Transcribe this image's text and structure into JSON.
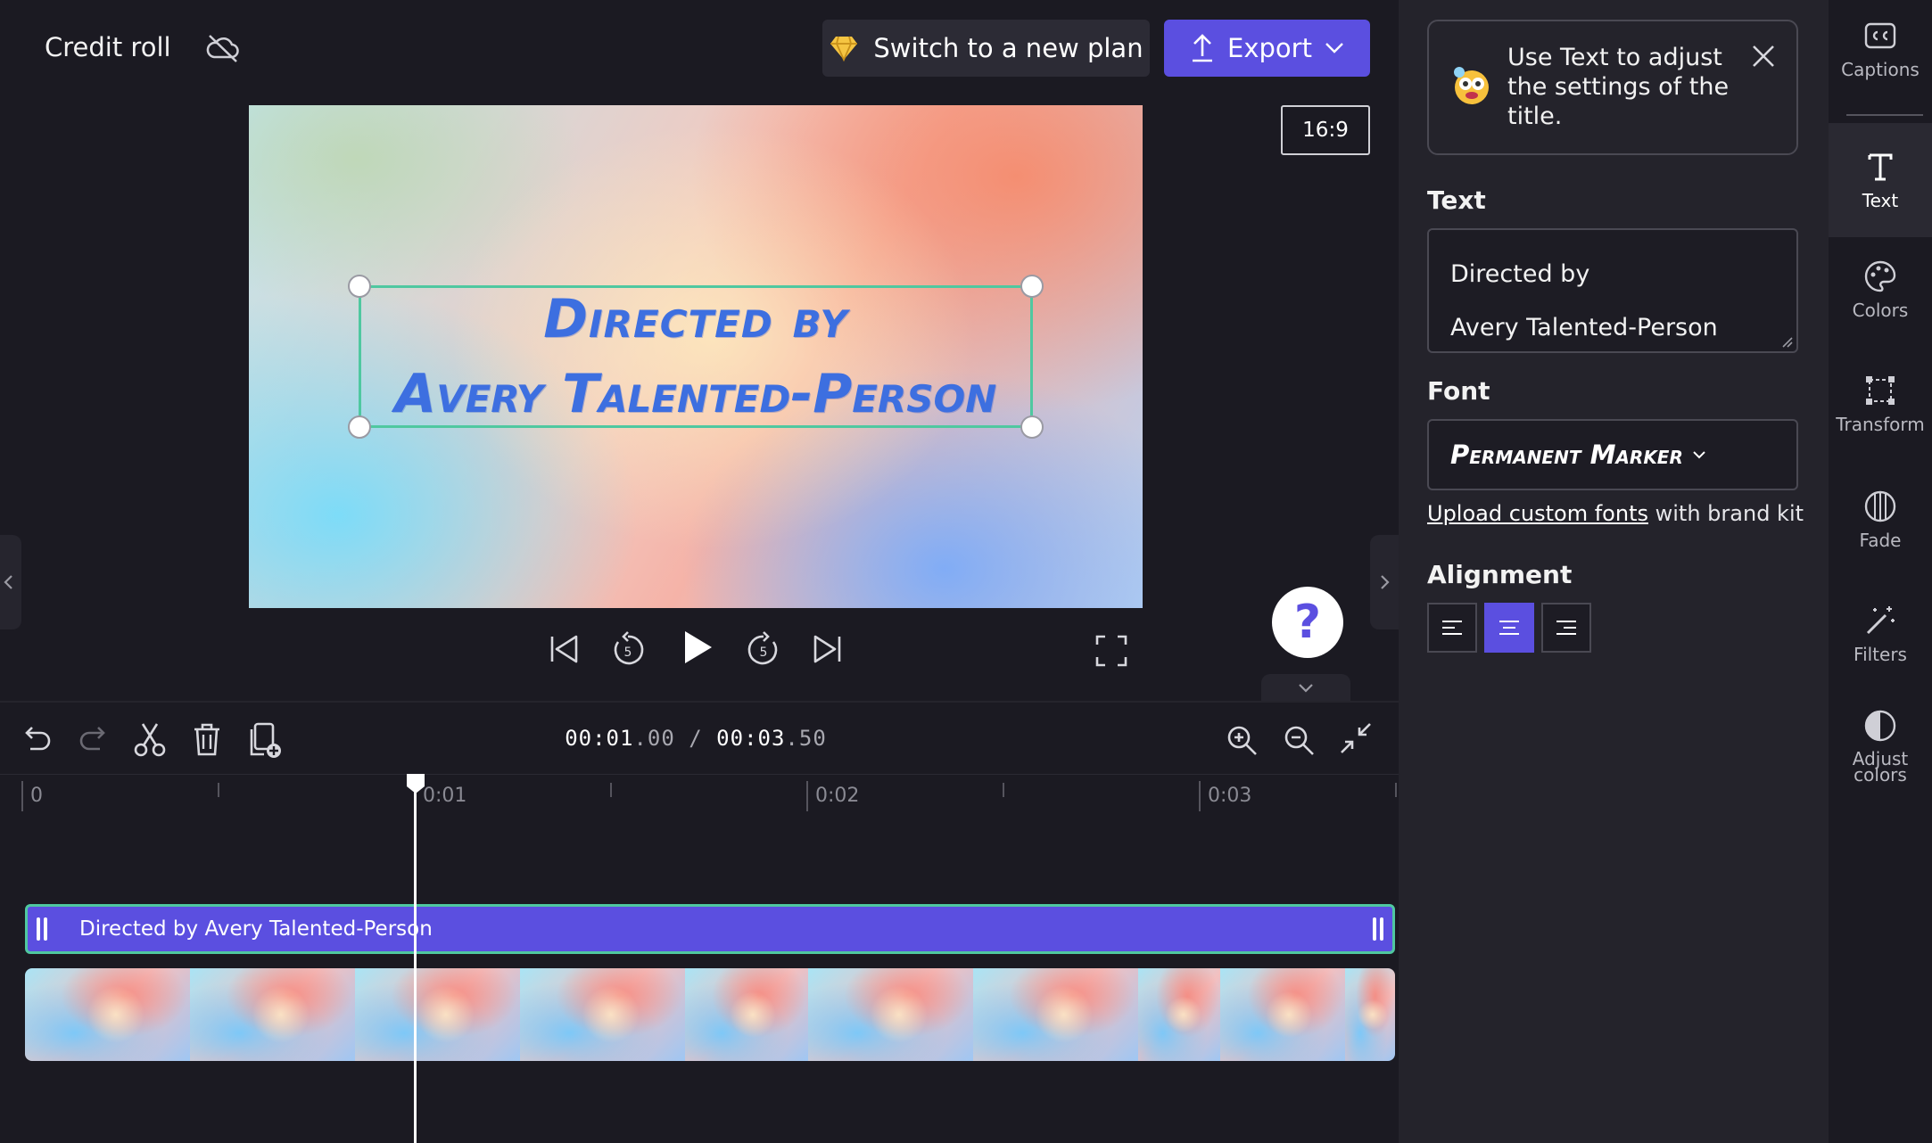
{
  "header": {
    "project_title": "Credit roll",
    "plan_button_label": "Switch to a new plan",
    "export_button_label": "Export",
    "aspect_ratio": "16:9"
  },
  "preview": {
    "title_line1": "Directed by",
    "title_line2": "Avery Talented-Person",
    "title_color": "#3d6fe0",
    "selection_color": "#4fc8a0"
  },
  "playback": {
    "current_time": "00:01",
    "current_frac": ".00",
    "separator": " / ",
    "total_time": "00:03",
    "total_frac": ".50"
  },
  "timeline": {
    "tick_labels": [
      "0",
      "0:01",
      "0:02",
      "0:03"
    ],
    "text_clip_label": "Directed by Avery Talented-Person",
    "playhead_seconds": 1.0
  },
  "panel": {
    "tip_text": "Use Text to adjust the settings of the title.",
    "text_heading": "Text",
    "text_value_line1": "Directed by",
    "text_value_line2": "Avery Talented-Person",
    "font_heading": "Font",
    "font_value": "Permanent Marker",
    "upload_link": "Upload custom fonts",
    "upload_rest": " with brand kit",
    "alignment_heading": "Alignment",
    "alignment_selected": "center"
  },
  "rail": [
    {
      "label": "Captions",
      "icon": "captions-icon"
    },
    {
      "label": "Text",
      "icon": "text-icon",
      "active": true
    },
    {
      "label": "Colors",
      "icon": "palette-icon"
    },
    {
      "label": "Transform",
      "icon": "transform-icon"
    },
    {
      "label": "Fade",
      "icon": "fade-icon"
    },
    {
      "label": "Filters",
      "icon": "magic-wand-icon"
    },
    {
      "label": "Adjust",
      "label2": "colors",
      "icon": "adjust-colors-icon"
    }
  ],
  "colors": {
    "accent": "#5b4fe0",
    "background": "#1b1a22",
    "panel": "#24232b"
  }
}
